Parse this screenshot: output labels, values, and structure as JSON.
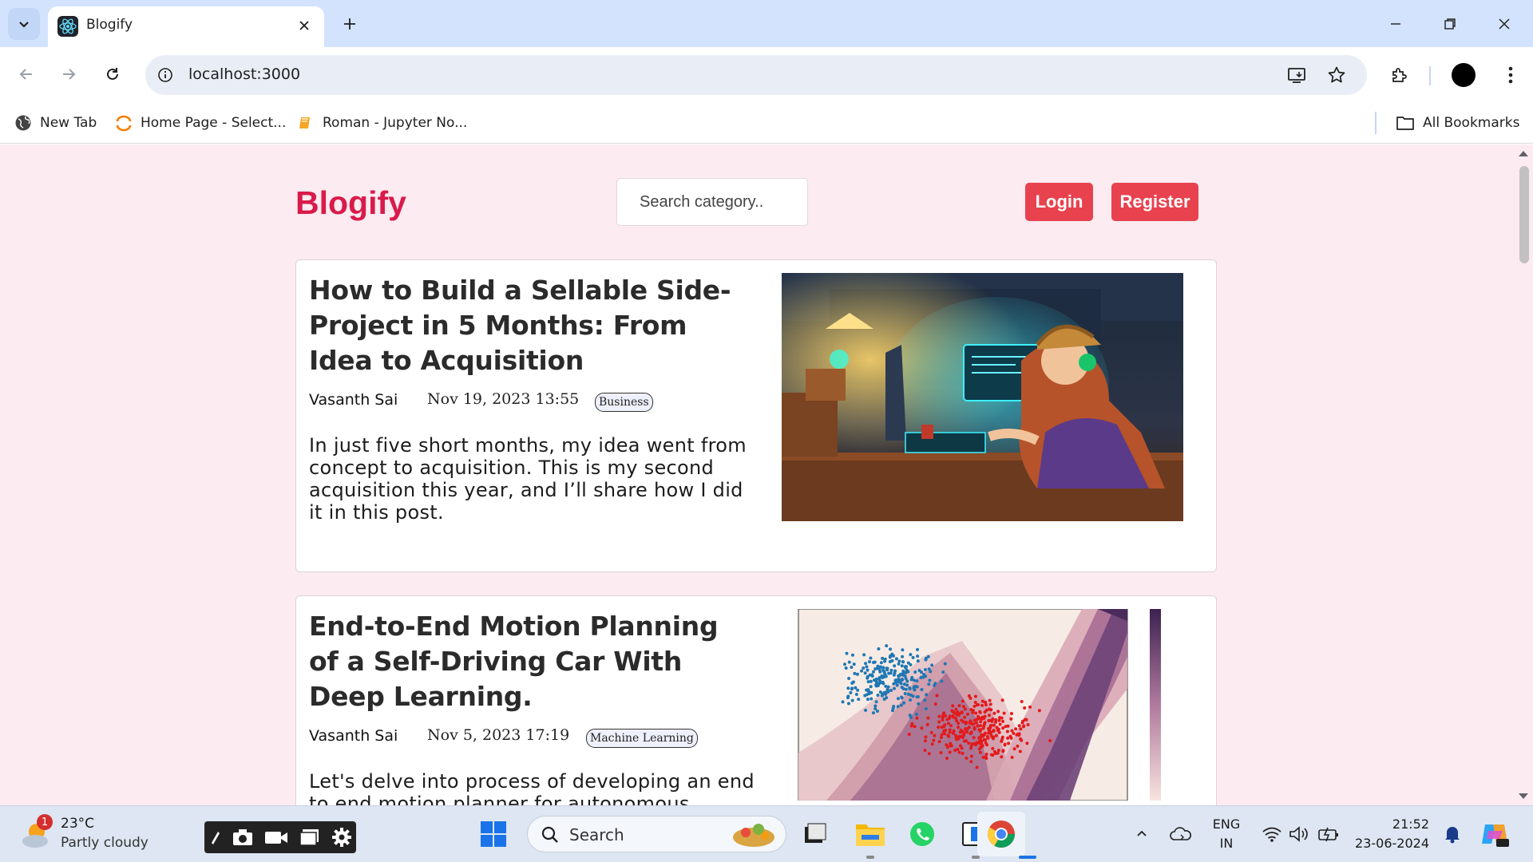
{
  "browser": {
    "tab_title": "Blogify",
    "url": "localhost:3000",
    "bookmarks": [
      {
        "label": "New Tab"
      },
      {
        "label": "Home Page - Select..."
      },
      {
        "label": "Roman - Jupyter No..."
      }
    ],
    "all_bookmarks_label": "All Bookmarks"
  },
  "header": {
    "brand": "Blogify",
    "search_placeholder": "Search category..",
    "login_label": "Login",
    "register_label": "Register"
  },
  "posts": [
    {
      "title": "How to Build a Sellable Side-Project in 5 Months: From Idea to Acquisition",
      "author": "Vasanth Sai",
      "date": "Nov 19, 2023 13:55",
      "category": "Business",
      "excerpt": "In just five short months, my idea went from concept to acquisition. This is my second acquisition this year, and I’ll share how I did it in this post."
    },
    {
      "title": "End-to-End Motion Planning of a Self-Driving Car With Deep Learning.",
      "author": "Vasanth Sai",
      "date": "Nov 5, 2023 17:19",
      "category": "Machine Learning",
      "excerpt": "Let's delve into process of developing an end to end motion planner for autonomous"
    }
  ],
  "taskbar": {
    "weather_temp": "23°C",
    "weather_desc": "Partly cloudy",
    "weather_badge": "1",
    "search_label": "Search",
    "lang_top": "ENG",
    "lang_bottom": "IN",
    "time": "21:52",
    "date": "23-06-2024"
  },
  "colors": {
    "brand": "#d81b4a",
    "button": "#e8424f",
    "page_bg": "#fcebf1"
  }
}
